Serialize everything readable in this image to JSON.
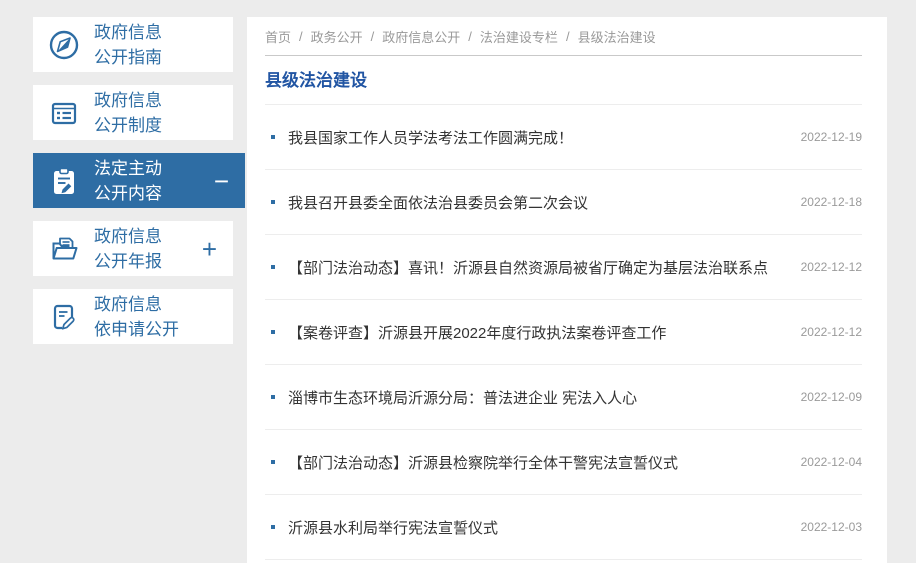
{
  "colors": {
    "accent_blue": "#2e6da4",
    "title_blue": "#2155a3",
    "page_background": "#ececec"
  },
  "sidebar": {
    "items": [
      {
        "line1": "政府信息",
        "line2": "公开指南",
        "icon": "compass-icon",
        "active": false,
        "toggle": ""
      },
      {
        "line1": "政府信息",
        "line2": "公开制度",
        "icon": "document-list-icon",
        "active": false,
        "toggle": ""
      },
      {
        "line1": "法定主动",
        "line2": "公开内容",
        "icon": "clipboard-pen-icon",
        "active": true,
        "toggle": "−"
      },
      {
        "line1": "政府信息",
        "line2": "公开年报",
        "icon": "folder-doc-icon",
        "active": false,
        "toggle": "+"
      },
      {
        "line1": "政府信息",
        "line2": "依申请公开",
        "icon": "doc-edit-icon",
        "active": false,
        "toggle": ""
      }
    ]
  },
  "breadcrumb": {
    "separator": "/",
    "items": [
      "首页",
      "政务公开",
      "政府信息公开",
      "法治建设专栏",
      "县级法治建设"
    ]
  },
  "main": {
    "section_title": "县级法治建设",
    "articles": [
      {
        "title": "我县国家工作人员学法考法工作圆满完成！",
        "date": "2022-12-19"
      },
      {
        "title": "我县召开县委全面依法治县委员会第二次会议",
        "date": "2022-12-18"
      },
      {
        "title": "【部门法治动态】喜讯！沂源县自然资源局被省厅确定为基层法治联系点",
        "date": "2022-12-12"
      },
      {
        "title": "【案卷评查】沂源县开展2022年度行政执法案卷评查工作",
        "date": "2022-12-12"
      },
      {
        "title": "淄博市生态环境局沂源分局：普法进企业 宪法入人心",
        "date": "2022-12-09"
      },
      {
        "title": "【部门法治动态】沂源县检察院举行全体干警宪法宣誓仪式",
        "date": "2022-12-04"
      },
      {
        "title": "沂源县水利局举行宪法宣誓仪式",
        "date": "2022-12-03"
      }
    ]
  }
}
